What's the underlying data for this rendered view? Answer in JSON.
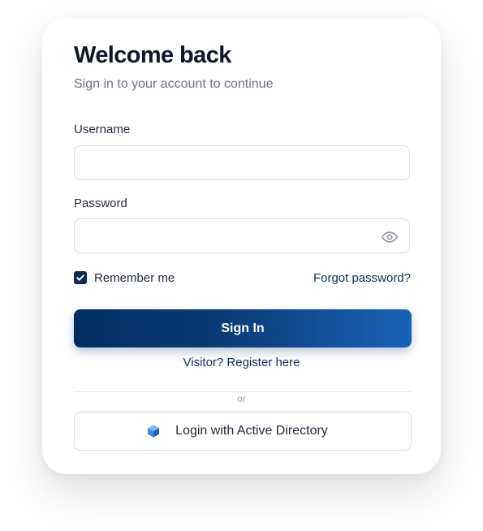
{
  "login": {
    "title": "Welcome back",
    "subtitle": "Sign in to your account to continue",
    "username": {
      "label": "Username",
      "value": "",
      "placeholder": ""
    },
    "password": {
      "label": "Password",
      "value": "",
      "placeholder": ""
    },
    "remember": {
      "label": "Remember me",
      "checked": true
    },
    "forgot_label": "Forgot password?",
    "signin_label": "Sign In",
    "register_label": "Visitor? Register here",
    "divider_label": "or",
    "ad_label": "Login with Active Directory"
  },
  "icons": {
    "password_toggle": "eye-icon",
    "checkbox": "checkmark-icon",
    "active_directory": "cube-icon"
  },
  "colors": {
    "primary": "#032d60",
    "accent": "#1a63b7",
    "link": "#0c2d5c",
    "title_text": "#0f172a",
    "muted_text": "#6b7280",
    "input_border": "#d9dde3"
  }
}
